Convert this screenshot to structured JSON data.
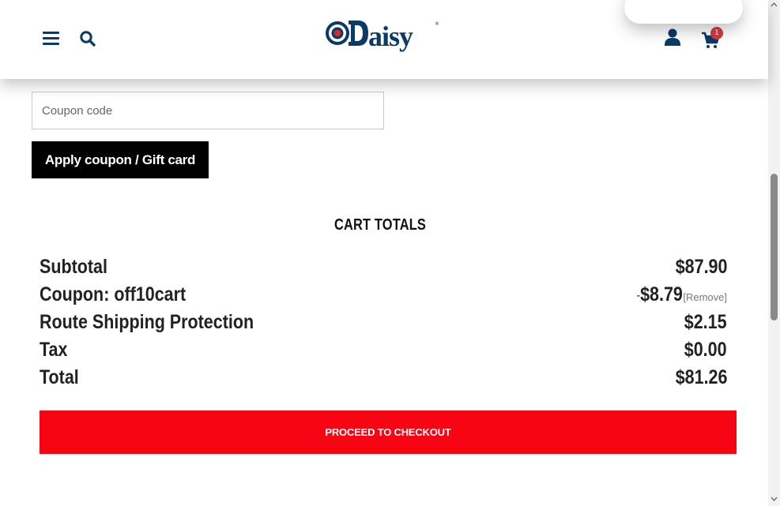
{
  "header": {
    "brand": "Daisy",
    "cart_count": "1"
  },
  "icons": {
    "menu": "hamburger-menu-icon",
    "search": "search-icon",
    "account": "user-account-icon",
    "cart": "shopping-cart-icon"
  },
  "coupon": {
    "placeholder": "Coupon code",
    "value": "",
    "apply_label": "Apply coupon / Gift card"
  },
  "cart_totals": {
    "title": "CART TOTALS",
    "rows": [
      {
        "label": "Subtotal",
        "value": "$87.90"
      },
      {
        "label": "Coupon: off10cart",
        "prefix": "-",
        "value": "$8.79",
        "action": "[Remove]"
      },
      {
        "label": "Route Shipping Protection",
        "value": "$2.15"
      },
      {
        "label": "Tax",
        "value": "$0.00"
      },
      {
        "label": "Total",
        "value": "$81.26"
      }
    ]
  },
  "checkout": {
    "label": "PROCEED TO CHECKOUT"
  },
  "colors": {
    "brand_navy": "#0c3a66",
    "brand_red": "#d9262f",
    "checkout_red": "#f70512",
    "apply_black": "#000000",
    "badge_red": "#d33b45"
  }
}
